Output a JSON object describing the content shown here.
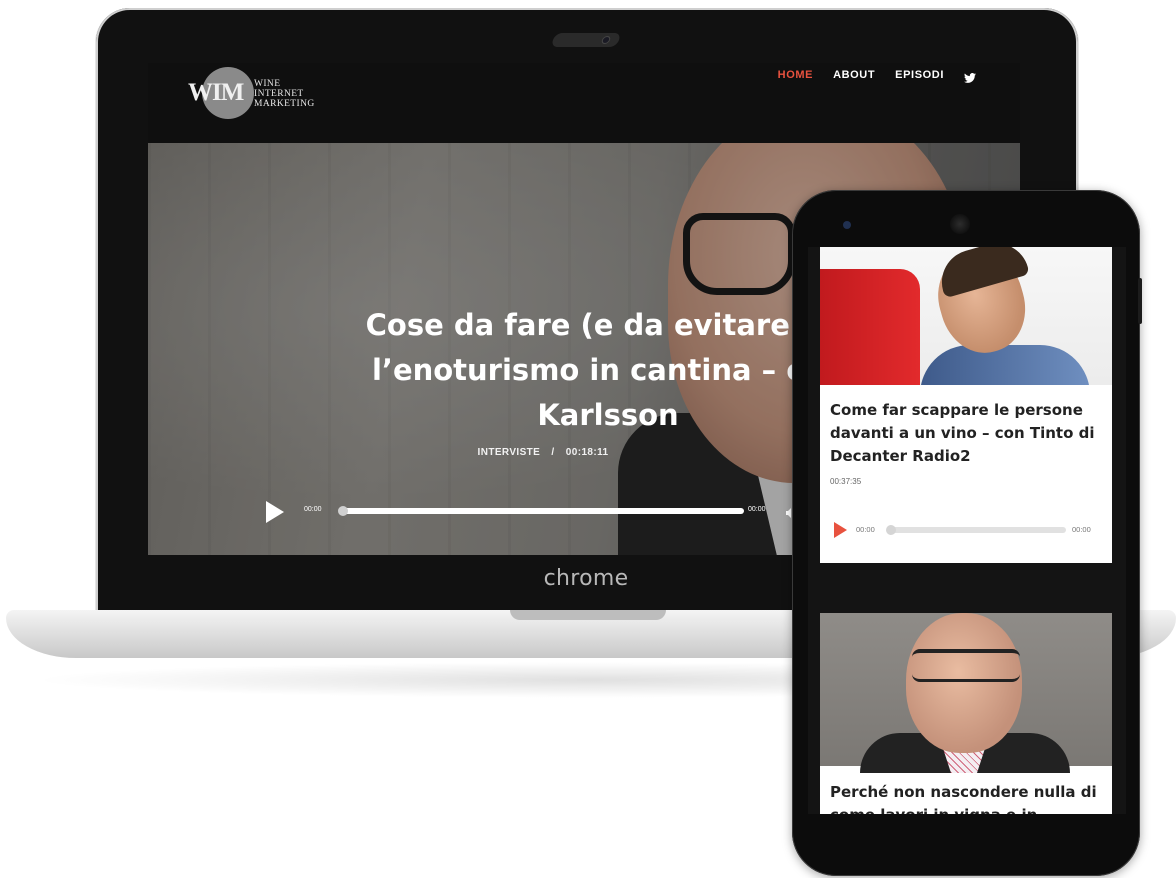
{
  "laptop": {
    "brand_label": "chrome",
    "site": {
      "logo": {
        "mark": "WIM",
        "lines": [
          "WINE",
          "INTERNET",
          "MARKETING"
        ]
      },
      "nav": [
        {
          "label": "HOME",
          "active": true
        },
        {
          "label": "ABOUT",
          "active": false
        },
        {
          "label": "EPISODI",
          "active": false
        }
      ],
      "social_icon": "twitter-icon",
      "hero": {
        "title": "Cose da fare (e da evitare) co\nl’enoturismo in cantina – con\nKarlsson",
        "category": "INTERVISTE",
        "separator": "/",
        "duration": "00:18:11",
        "player": {
          "time_start": "00:00",
          "time_end": "00:00",
          "progress": 0
        }
      }
    }
  },
  "phone": {
    "cards": [
      {
        "title": "Come far scappare le persone\ndavanti a un vino – con Tinto di\nDecanter Radio2",
        "duration": "00:37:35",
        "player": {
          "time_start": "00:00",
          "time_end": "00:00",
          "progress": 0
        }
      },
      {
        "title": "Perché non nascondere nulla di\ncome lavori in vigna e in cantina"
      }
    ]
  },
  "colors": {
    "accent": "#e8523f",
    "header_bg": "#0f0f0f",
    "device_frame": "#111111"
  }
}
